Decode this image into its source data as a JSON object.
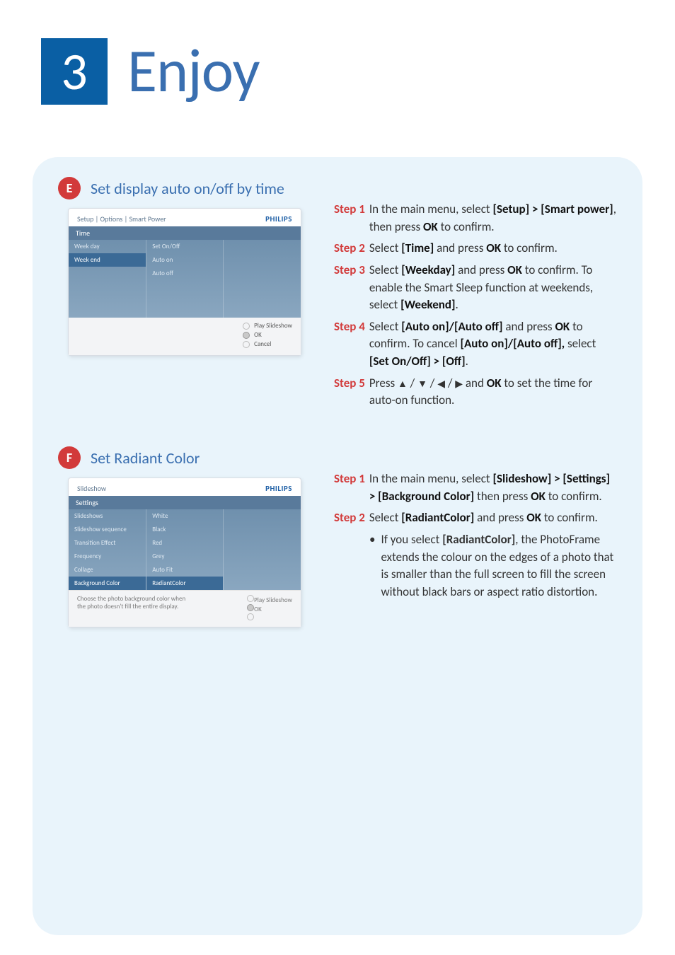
{
  "header": {
    "number": "3",
    "title": "Enjoy"
  },
  "sectionE": {
    "pill": "E",
    "title": "Set display auto on/off by time",
    "device": {
      "breadcrumb": "Setup | Options | Smart Power",
      "brand": "PHILIPS",
      "bar": "Time",
      "col1": [
        "Week day",
        "Week end"
      ],
      "col1_selected": 1,
      "col2": [
        "Set On/Off",
        "Auto on",
        "Auto off"
      ],
      "footer": [
        "Play Slideshow",
        "OK",
        "Cancel"
      ]
    },
    "steps": [
      {
        "label": "Step 1",
        "html": "In the main menu, select <b>[Setup] > [Smart power]</b>, then press <b>OK</b> to confirm."
      },
      {
        "label": "Step 2",
        "html": "Select <b>[Time]</b> and press <b>OK</b> to confirm."
      },
      {
        "label": "Step 3",
        "html": "Select <b>[Weekday]</b> and press <b>OK</b> to confirm. To enable the Smart Sleep function at weekends, select <b>[Weekend]</b>."
      },
      {
        "label": "Step 4",
        "html": "Select <b>[Auto on]/[Auto off]</b> and press <b>OK</b> to confirm. To cancel <b>[Auto on]/[Auto off],</b> select <b>[Set On/Off] > [Off]</b>."
      },
      {
        "label": "Step 5",
        "html": "Press <span class='arrow'>▲</span> / <span class='arrow'>▼</span> / <span class='arrow'>◀</span> / <span class='arrow'>▶</span> and <b>OK</b> to set the time for auto-on function."
      }
    ]
  },
  "sectionF": {
    "pill": "F",
    "title": "Set Radiant Color",
    "device": {
      "breadcrumb": "Slideshow",
      "brand": "PHILIPS",
      "bar": "Settings",
      "col1": [
        "Slideshows",
        "Slideshow sequence",
        "Transition Effect",
        "Frequency",
        "Collage",
        "Background Color"
      ],
      "col1_selected": 5,
      "col2": [
        "White",
        "Black",
        "Red",
        "Grey",
        "Auto Fit",
        "RadiantColor"
      ],
      "col2_selected": 5,
      "hint": "Choose the photo background color when the photo doesn't fill the entire display.",
      "footer": [
        "Play Slideshow",
        "OK"
      ]
    },
    "steps": [
      {
        "label": "Step 1",
        "html": "In the main menu, select <b>[Slideshow] > [Settings] > [Background Color]</b> then press <b>OK</b> to confirm."
      },
      {
        "label": "Step 2",
        "html": "Select <b>[RadiantColor]</b> and press <b>OK</b> to confirm."
      }
    ],
    "bullet": "If you select <b>[RadiantColor]</b>, the PhotoFrame extends the colour on the edges of a photo that is smaller than the full screen to fill the screen without black bars or aspect ratio distortion."
  }
}
